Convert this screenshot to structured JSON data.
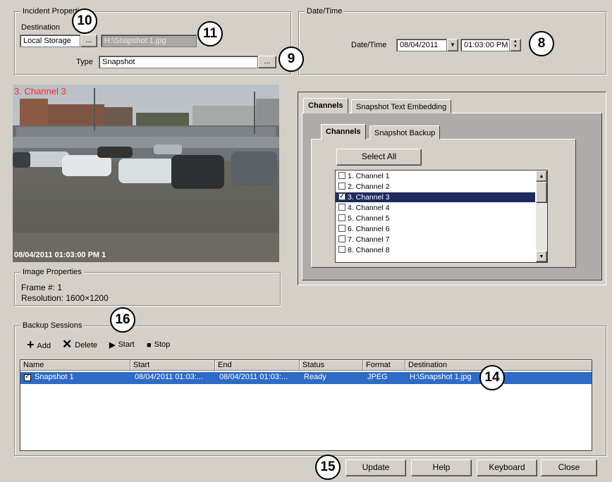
{
  "incident": {
    "group_title": "Incident Properties",
    "destination_label": "Destination",
    "destination_value": "Local Storage",
    "browse_label": "...",
    "path_value": "H:\\Snapshot 1.jpg",
    "type_label": "Type",
    "type_value": "Snapshot",
    "type_browse_label": "..."
  },
  "datetime": {
    "group_title": "Date/Time",
    "label": "Date/Time",
    "date_value": "08/04/2011",
    "time_value": "01:03:00 PM"
  },
  "callouts": [
    "10",
    "11",
    "9",
    "8",
    "16",
    "14",
    "15"
  ],
  "camera": {
    "channel_label": "3. Channel 3",
    "timestamp": "08/04/2011 01:03:00 PM 1",
    "channel_color": "#ff2a2a"
  },
  "image_properties": {
    "group_title": "Image Properties",
    "frame": "Frame #: 1",
    "resolution": "Resolution: 1600×1200"
  },
  "outer_tabs": [
    "Channels",
    "Snapshot Text Embedding"
  ],
  "inner_tabs": [
    "Channels",
    "Snapshot Backup"
  ],
  "select_all_label": "Select All",
  "channels": [
    {
      "label": "1. Channel 1",
      "checked": false,
      "selected": false
    },
    {
      "label": "2. Channel 2",
      "checked": false,
      "selected": false
    },
    {
      "label": "3. Channel 3",
      "checked": true,
      "selected": true
    },
    {
      "label": "4. Channel 4",
      "checked": false,
      "selected": false
    },
    {
      "label": "5. Channel 5",
      "checked": false,
      "selected": false
    },
    {
      "label": "6. Channel 6",
      "checked": false,
      "selected": false
    },
    {
      "label": "7. Channel 7",
      "checked": false,
      "selected": false
    },
    {
      "label": "8. Channel 8",
      "checked": false,
      "selected": false
    }
  ],
  "backup": {
    "group_title": "Backup Sessions",
    "toolbar": {
      "add": "Add",
      "delete": "Delete",
      "start": "Start",
      "stop": "Stop"
    },
    "columns": [
      "Name",
      "Start",
      "End",
      "Status",
      "Format",
      "Destination"
    ],
    "rows": [
      {
        "name": "Snapshot 1",
        "start": "08/04/2011 01:03:...",
        "end": "08/04/2011 01:03:...",
        "status": "Ready",
        "format": "JPEG",
        "destination": "H:\\Snapshot 1.jpg",
        "checked": true
      }
    ]
  },
  "footer": {
    "update": "Update",
    "help": "Help",
    "keyboard": "Keyboard",
    "close": "Close"
  },
  "colors": {
    "selection": "#1e2a5e",
    "row_selection": "#2e6bc6",
    "window_bg": "#d4d0c8"
  }
}
